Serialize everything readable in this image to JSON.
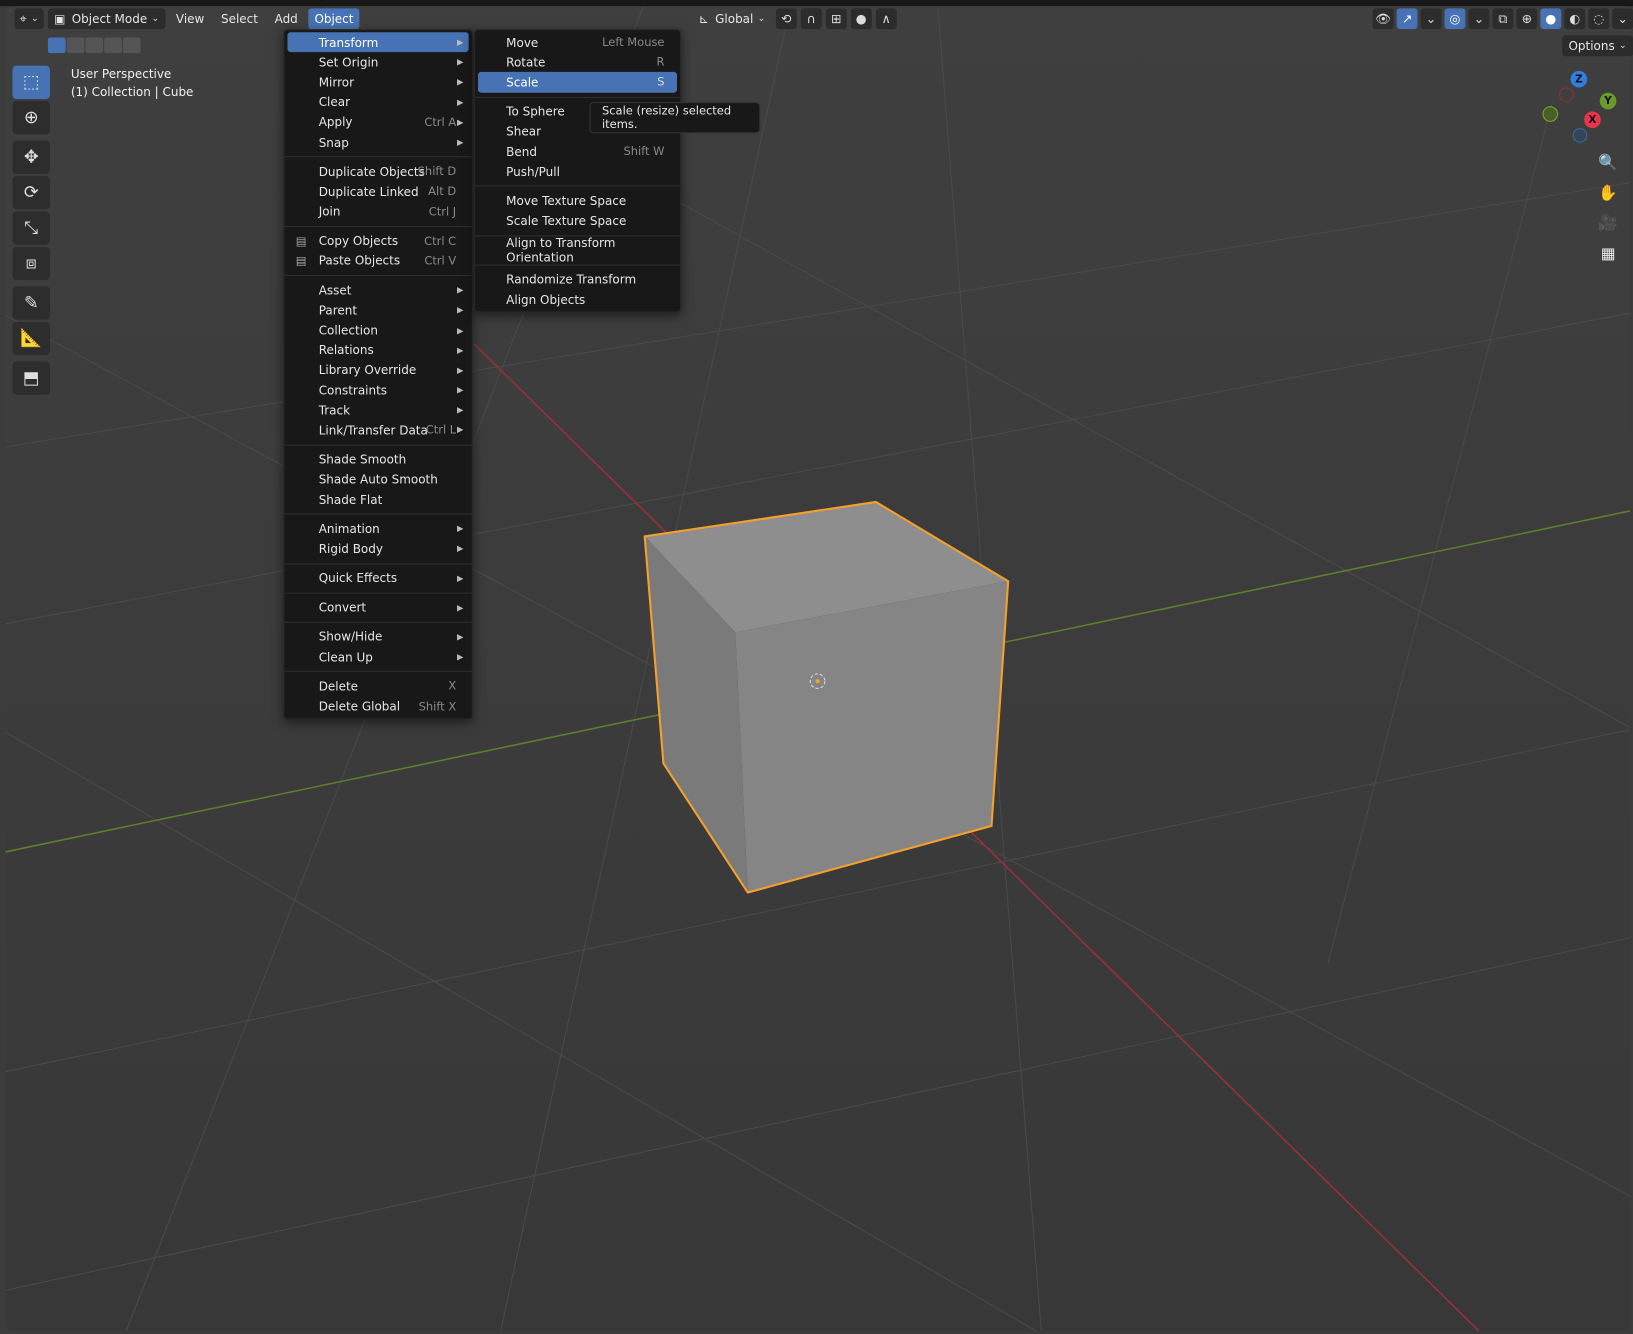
{
  "header": {
    "editor_type_icon": "3d-viewport-icon",
    "mode": "Object Mode",
    "menus": [
      "View",
      "Select",
      "Add",
      "Object"
    ],
    "active_menu": "Object",
    "orientation": "Global",
    "options": "Options"
  },
  "viewport": {
    "perspective": "User Perspective",
    "collection": "(1) Collection | Cube"
  },
  "colors": {
    "accent": "#4772b3",
    "selection": "#f5a623",
    "x_axis": "#c8323c",
    "y_axis": "#6c9a2a",
    "z_axis": "#2f7fe0"
  },
  "toolbar": [
    "select-box-icon",
    "cursor-icon",
    "move-icon",
    "rotate-icon",
    "scale-icon",
    "transform-icon",
    "annotate-icon",
    "measure-icon",
    "add-cube-icon"
  ],
  "object_menu": [
    {
      "label": "Transform",
      "arrow": true,
      "highlight": true
    },
    {
      "label": "Set Origin",
      "arrow": true
    },
    {
      "label": "Mirror",
      "arrow": true
    },
    {
      "label": "Clear",
      "arrow": true
    },
    {
      "label": "Apply",
      "shortcut": "Ctrl A",
      "arrow": true
    },
    {
      "label": "Snap",
      "arrow": true
    },
    {
      "sep": true
    },
    {
      "label": "Duplicate Objects",
      "shortcut": "Shift D"
    },
    {
      "label": "Duplicate Linked",
      "shortcut": "Alt D"
    },
    {
      "label": "Join",
      "shortcut": "Ctrl J"
    },
    {
      "sep": true
    },
    {
      "label": "Copy Objects",
      "shortcut": "Ctrl C",
      "icon": "copy-icon"
    },
    {
      "label": "Paste Objects",
      "shortcut": "Ctrl V",
      "icon": "paste-icon"
    },
    {
      "sep": true
    },
    {
      "label": "Asset",
      "arrow": true
    },
    {
      "label": "Parent",
      "arrow": true
    },
    {
      "label": "Collection",
      "arrow": true
    },
    {
      "label": "Relations",
      "arrow": true
    },
    {
      "label": "Library Override",
      "arrow": true
    },
    {
      "label": "Constraints",
      "arrow": true
    },
    {
      "label": "Track",
      "arrow": true
    },
    {
      "label": "Link/Transfer Data",
      "shortcut": "Ctrl L",
      "arrow": true
    },
    {
      "sep": true
    },
    {
      "label": "Shade Smooth"
    },
    {
      "label": "Shade Auto Smooth"
    },
    {
      "label": "Shade Flat"
    },
    {
      "sep": true
    },
    {
      "label": "Animation",
      "arrow": true
    },
    {
      "label": "Rigid Body",
      "arrow": true
    },
    {
      "sep": true
    },
    {
      "label": "Quick Effects",
      "arrow": true
    },
    {
      "sep": true
    },
    {
      "label": "Convert",
      "arrow": true
    },
    {
      "sep": true
    },
    {
      "label": "Show/Hide",
      "arrow": true
    },
    {
      "label": "Clean Up",
      "arrow": true
    },
    {
      "sep": true
    },
    {
      "label": "Delete",
      "shortcut": "X"
    },
    {
      "label": "Delete Global",
      "shortcut": "Shift X"
    }
  ],
  "transform_menu": [
    {
      "label": "Move",
      "shortcut": "Left Mouse"
    },
    {
      "label": "Rotate",
      "shortcut": "R"
    },
    {
      "label": "Scale",
      "shortcut": "S",
      "highlight": true
    },
    {
      "sep": true
    },
    {
      "label": "To Sphere"
    },
    {
      "label": "Shear"
    },
    {
      "label": "Bend",
      "shortcut": "Shift W"
    },
    {
      "label": "Push/Pull"
    },
    {
      "sep": true
    },
    {
      "label": "Move Texture Space"
    },
    {
      "label": "Scale Texture Space"
    },
    {
      "sep": true
    },
    {
      "label": "Align to Transform Orientation"
    },
    {
      "sep": true
    },
    {
      "label": "Randomize Transform"
    },
    {
      "label": "Align Objects"
    }
  ],
  "tooltip": "Scale (resize) selected items.",
  "gizmo": {
    "z": "Z",
    "y": "Y",
    "x": "X"
  }
}
